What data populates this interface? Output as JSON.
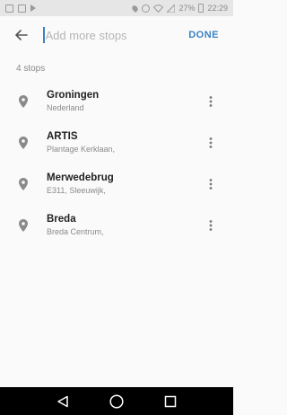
{
  "status_bar": {
    "battery_percent": "27%",
    "time": "22:29",
    "icons": [
      "image-icon",
      "gallery-icon",
      "play-store-icon",
      "location-icon",
      "data-saver-icon",
      "wifi-icon",
      "signal-icon",
      "battery-icon"
    ]
  },
  "header": {
    "back_icon": "arrow-left-icon",
    "search_placeholder": "Add more stops",
    "done_label": "DONE",
    "accent_color": "#3b82c4"
  },
  "stops_count_label": "4 stops",
  "stops": [
    {
      "name": "Groningen",
      "subtitle": "Nederland"
    },
    {
      "name": "ARTIS",
      "subtitle": "Plantage Kerklaan,"
    },
    {
      "name": "Merwedebrug",
      "subtitle": "E311, Sleeuwijk,"
    },
    {
      "name": "Breda",
      "subtitle": "Breda Centrum,"
    }
  ],
  "nav_bar": {
    "icons": [
      "back-triangle-icon",
      "home-circle-icon",
      "recents-square-icon"
    ]
  }
}
